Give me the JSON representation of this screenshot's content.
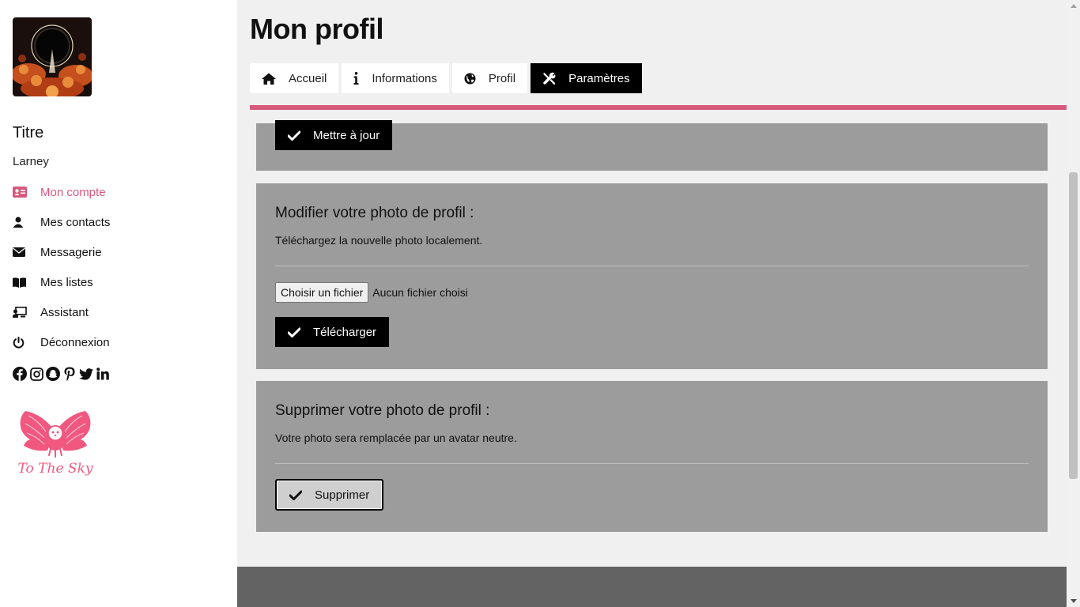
{
  "sidebar": {
    "site_title": "Titre",
    "username": "Larney",
    "nav": [
      {
        "label": "Mon compte",
        "icon": "id-card-icon",
        "active": true
      },
      {
        "label": "Mes contacts",
        "icon": "user-icon"
      },
      {
        "label": "Messagerie",
        "icon": "envelope-icon"
      },
      {
        "label": "Mes listes",
        "icon": "book-icon"
      },
      {
        "label": "Assistant",
        "icon": "chalkboard-icon"
      },
      {
        "label": "Déconnexion",
        "icon": "power-icon"
      }
    ],
    "socials": [
      "facebook-icon",
      "instagram-icon",
      "snapchat-icon",
      "pinterest-icon",
      "twitter-icon",
      "linkedin-icon"
    ],
    "logo_text": "To The Sky"
  },
  "main": {
    "page_title": "Mon profil",
    "tabs": [
      {
        "label": "Accueil",
        "icon": "home-icon"
      },
      {
        "label": "Informations",
        "icon": "info-icon"
      },
      {
        "label": "Profil",
        "icon": "globe-icon"
      },
      {
        "label": "Paramètres",
        "icon": "tools-icon",
        "active": true
      }
    ],
    "update_card": {
      "button": "Mettre à jour"
    },
    "upload_card": {
      "heading": "Modifier votre photo de profil :",
      "description": "Téléchargez la nouvelle photo localement.",
      "file_button": "Choisir un fichier",
      "file_status": "Aucun fichier choisi",
      "button": "Télécharger"
    },
    "delete_card": {
      "heading": "Supprimer votre photo de profil :",
      "description": "Votre photo sera remplacée par un avatar neutre.",
      "button": "Supprimer"
    }
  },
  "colors": {
    "accent": "#d6587d",
    "card": "#9c9c9c",
    "main_bg": "#f0f0f0",
    "footer": "#636363"
  }
}
